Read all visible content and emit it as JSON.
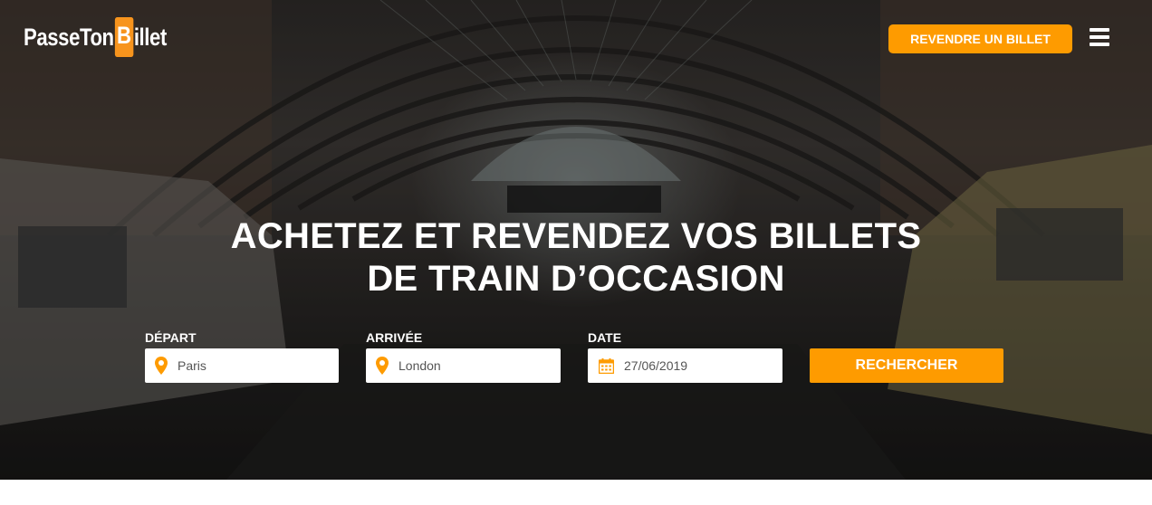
{
  "header": {
    "logo_part1": "PasseTon",
    "logo_ticket_letter": "B",
    "logo_part2": "illet",
    "resell_label": "REVENDRE UN BILLET",
    "menu_icon": "hamburger-menu-icon"
  },
  "hero": {
    "headline_line1": "ACHETEZ ET REVENDEZ VOS BILLETS",
    "headline_line2": "DE TRAIN D’OCCASION",
    "background_image": "train-station-platform"
  },
  "search": {
    "departure": {
      "label": "DÉPART",
      "value": "Paris",
      "icon": "map-pin-icon"
    },
    "arrival": {
      "label": "ARRIVÉE",
      "value": "London",
      "icon": "map-pin-icon"
    },
    "date": {
      "label": "DATE",
      "value": "27/06/2019",
      "icon": "calendar-icon"
    },
    "submit_label": "RECHERCHER"
  },
  "colors": {
    "accent": "#fe9b00",
    "text_on_dark": "#ffffff"
  }
}
